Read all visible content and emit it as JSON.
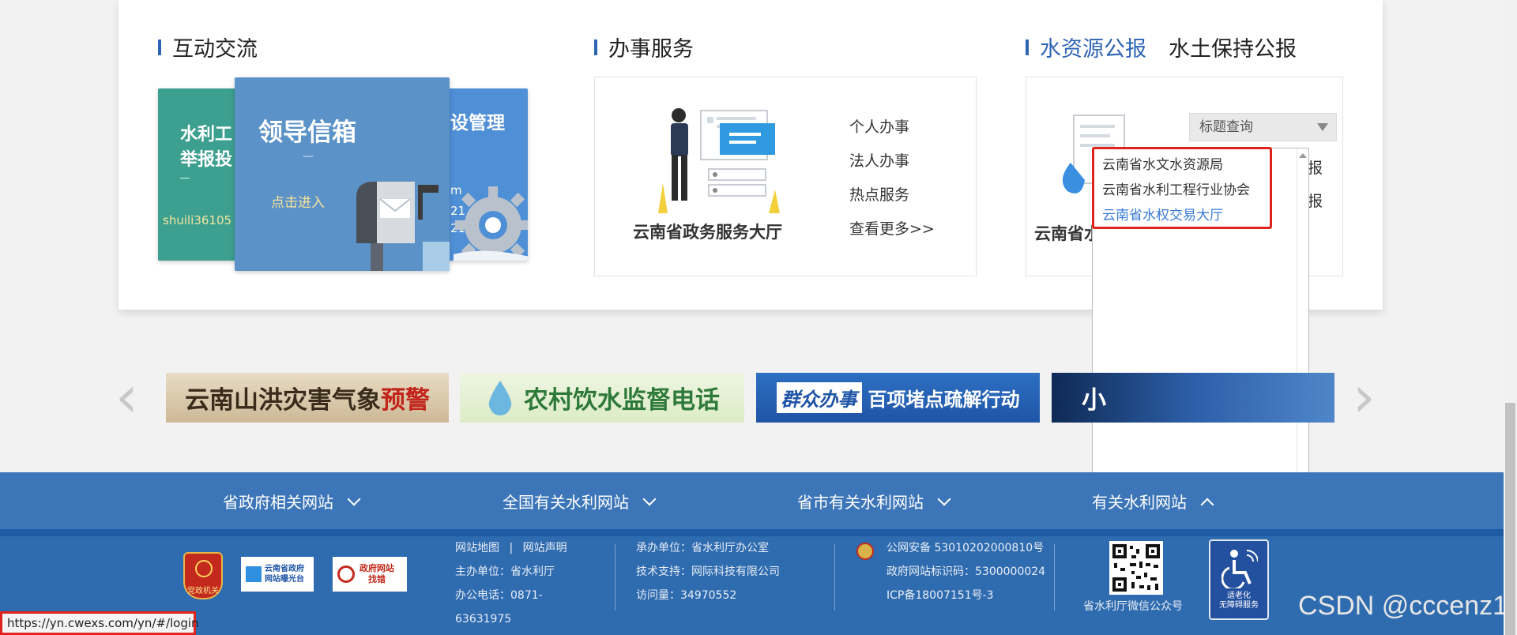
{
  "interaction": {
    "title": "互动交流"
  },
  "tiles": {
    "back_left": {
      "line1": "水利工",
      "line2": "举报投",
      "sub": "shuili36105"
    },
    "front": {
      "title": "领导信箱",
      "dash": "—",
      "link": "点击进入"
    },
    "back_right": {
      "title": "设管理",
      "text1": "m",
      "text2": "21",
      "text3": "21"
    }
  },
  "services": {
    "title": "办事服务",
    "caption": "云南省政务服务大厅",
    "links": [
      "个人办事",
      "法人办事",
      "热点服务",
      "查看更多>>"
    ]
  },
  "water": {
    "tabs": [
      "水资源公报",
      "水土保持公报"
    ],
    "caption": "云南省水",
    "select_value": "标题查询",
    "partial_links": [
      "报",
      "报"
    ],
    "dropdown_options": [
      "云南省水文水资源局",
      "云南省水利工程行业协会",
      "云南省水权交易大厅"
    ]
  },
  "banners": [
    {
      "text": "云南山洪灾害气象",
      "accent": "预警"
    },
    {
      "text": "农村饮水监督电话"
    },
    {
      "tag": "群众办事",
      "text": "百项堵点疏解行动"
    },
    {
      "text": "小"
    }
  ],
  "carousel": {
    "prev": "‹",
    "next": "›"
  },
  "footer_nav": [
    {
      "label": "省政府相关网站",
      "state": "collapsed"
    },
    {
      "label": "全国有关水利网站",
      "state": "collapsed"
    },
    {
      "label": "省市有关水利网站",
      "state": "collapsed"
    },
    {
      "label": "有关水利网站",
      "state": "expanded"
    }
  ],
  "footer": {
    "badges": {
      "party": "党政机关",
      "gov_line1": "云南省政府",
      "gov_line2": "网站曝光台",
      "err_line1": "政府网站",
      "err_line2": "找错"
    },
    "sitemap": "网站地图",
    "divider": "|",
    "statement": "网站声明",
    "host": "主办单位：省水利厅",
    "phone_label": "办公电话：0871-",
    "phone_cont": "63631975",
    "organizer": "承办单位：省水利厅办公室",
    "tech": "技术支持：网际科技有限公司",
    "visits": "访问量：34970552",
    "police": "公网安备 53010202000810号",
    "gov_id": "政府网站标识码：5300000024",
    "icp": "ICP备18007151号-3",
    "qr_caption": "省水利厅微信公众号",
    "access_line1": "适老化",
    "access_line2": "无障碍服务"
  },
  "status_url": "https://yn.cwexs.com/yn/#/login",
  "watermark": "CSDN @cccenz1"
}
